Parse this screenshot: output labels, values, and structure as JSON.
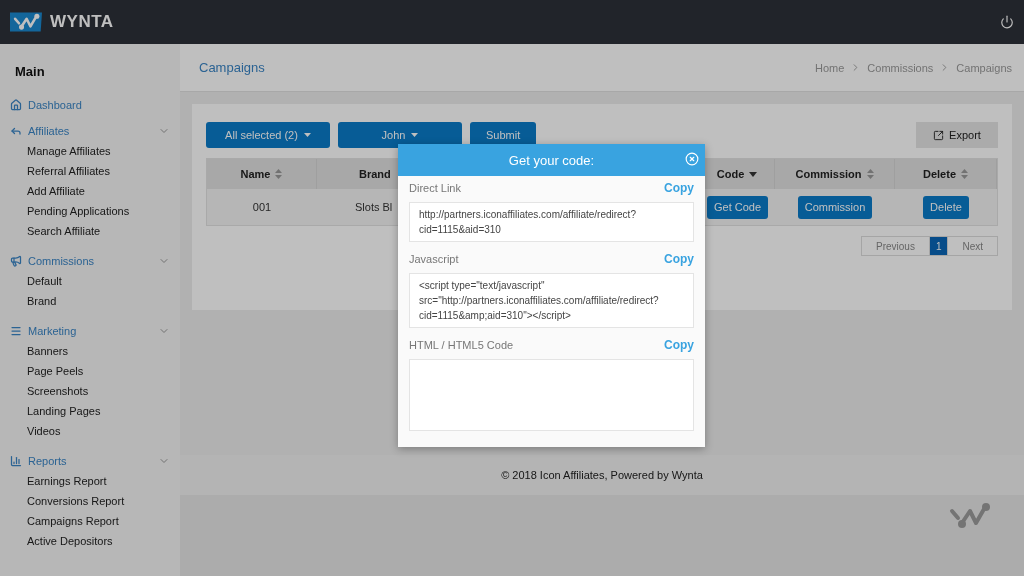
{
  "topbar": {
    "brand": "WYNTA"
  },
  "sidebar": {
    "heading": "Main",
    "groups": [
      {
        "label": "Dashboard"
      },
      {
        "label": "Affiliates",
        "children": [
          "Manage Affiliates",
          "Referral Affiliates",
          "Add Affiliate",
          "Pending Applications",
          "Search Affiliate"
        ]
      },
      {
        "label": "Commissions",
        "children": [
          "Default",
          "Brand"
        ]
      },
      {
        "label": "Marketing",
        "children": [
          "Banners",
          "Page Peels",
          "Screenshots",
          "Landing Pages",
          "Videos"
        ]
      },
      {
        "label": "Reports",
        "children": [
          "Earnings Report",
          "Conversions Report",
          "Campaigns Report",
          "Active Depositors"
        ]
      }
    ]
  },
  "page": {
    "title": "Campaigns",
    "breadcrumb": [
      "Home",
      "Commissions",
      "Campaigns"
    ]
  },
  "toolbar": {
    "filters": [
      "All selected (2)",
      "John"
    ],
    "submit": "Submit",
    "export": "Export"
  },
  "table": {
    "columns": [
      {
        "label": "Name",
        "sorted": false
      },
      {
        "label": "Brand"
      },
      {
        "label": "Code",
        "sorted": true
      },
      {
        "label": "Commission",
        "sorted": false
      },
      {
        "label": "Delete",
        "sorted": false
      }
    ],
    "rows": [
      {
        "cells": [
          {
            "kind": "text",
            "text": "001"
          },
          {
            "kind": "text",
            "text": "Slots Bl"
          },
          {
            "kind": "button",
            "text": "Get Code"
          },
          {
            "kind": "button",
            "text": "Commission"
          },
          {
            "kind": "button",
            "text": "Delete"
          }
        ]
      }
    ]
  },
  "pagination": [
    {
      "label": "Previous",
      "selected": false
    },
    {
      "label": "1",
      "selected": true
    },
    {
      "label": "Next",
      "selected": false
    }
  ],
  "footer": "© 2018 Icon Affiliates, Powered by Wynta",
  "modal": {
    "title": "Get your code:",
    "sections": [
      {
        "label": "Direct Link",
        "copy": "Copy",
        "value": "http://partners.iconaffiliates.com/affiliate/redirect?cid=1115&aid=310"
      },
      {
        "label": "Javascript",
        "copy": "Copy",
        "value": "<script type=\"text/javascript\" src=\"http://partners.iconaffiliates.com/affiliate/redirect?cid=1115&amp;aid=310\"></script>"
      },
      {
        "label": "HTML / HTML5 Code",
        "copy": "Copy"
      }
    ]
  }
}
